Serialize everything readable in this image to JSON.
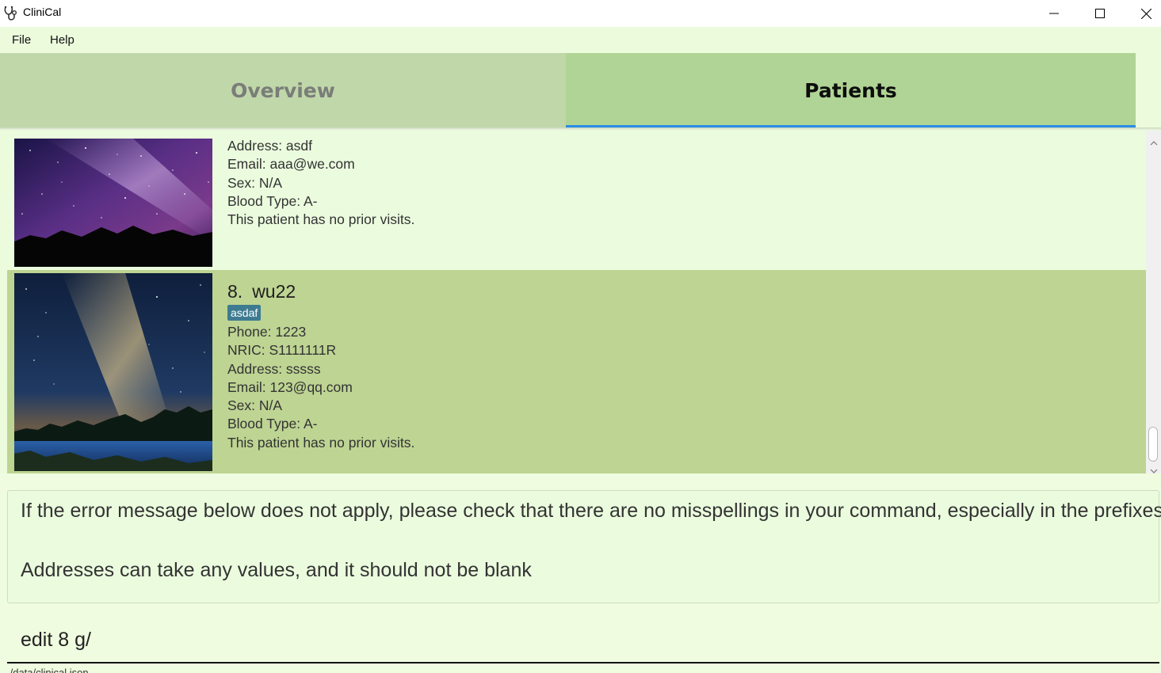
{
  "window": {
    "title": "CliniCal",
    "icons": {
      "app": "stethoscope-icon",
      "minimize": "minimize-icon",
      "maximize": "maximize-icon",
      "close": "close-icon"
    }
  },
  "menu": {
    "items": [
      "File",
      "Help"
    ]
  },
  "tabs": [
    {
      "label": "Overview",
      "selected": false
    },
    {
      "label": "Patients",
      "selected": true
    }
  ],
  "colors": {
    "tab_accent": "#2b8de3",
    "selected_card": "#bed493",
    "tag": "#3e7b91",
    "background": "#effcdf"
  },
  "patients": [
    {
      "lines": [
        "Address: asdf",
        "Email: aaa@we.com",
        "Sex: N/A",
        "Blood Type: A-",
        "This patient has no prior visits."
      ]
    },
    {
      "index": "8.",
      "name": "wu22",
      "tag": "asdaf",
      "selected": true,
      "lines": [
        "Phone: 1223",
        "NRIC: S1111111R",
        "Address: sssss",
        "Email: 123@qq.com",
        "Sex: N/A",
        "Blood Type: A-",
        "This patient has no prior visits."
      ]
    }
  ],
  "result": {
    "line1": "If the error message below does not apply, please check that there are no misspellings in your command, especially in the prefixes!",
    "line2": "Addresses can take any values, and it should not be blank"
  },
  "command": {
    "value": "edit 8 g/"
  },
  "status": {
    "text": "./data/clinical.json"
  }
}
